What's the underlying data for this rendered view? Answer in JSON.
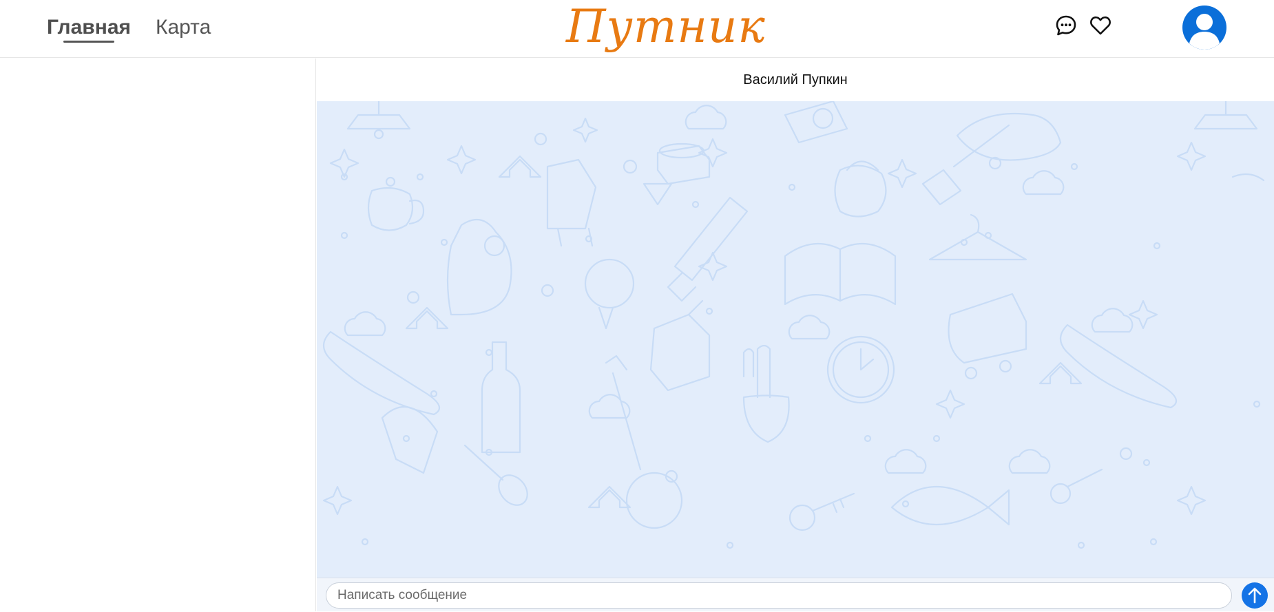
{
  "header": {
    "nav": {
      "home": "Главная",
      "map": "Карта"
    },
    "logo": "Путник",
    "icons": {
      "chat": "chat-bubble-icon",
      "favorites": "heart-icon",
      "profile": "user-avatar-icon"
    }
  },
  "chat": {
    "contact_name": "Василий Пупкин",
    "input_placeholder": "Написать сообщение",
    "send_icon": "arrow-up-icon"
  },
  "colors": {
    "brand": "#e87a12",
    "accent": "#1473e6",
    "chat_background": "#e3edfb",
    "doodle": "#c8dcf6"
  }
}
